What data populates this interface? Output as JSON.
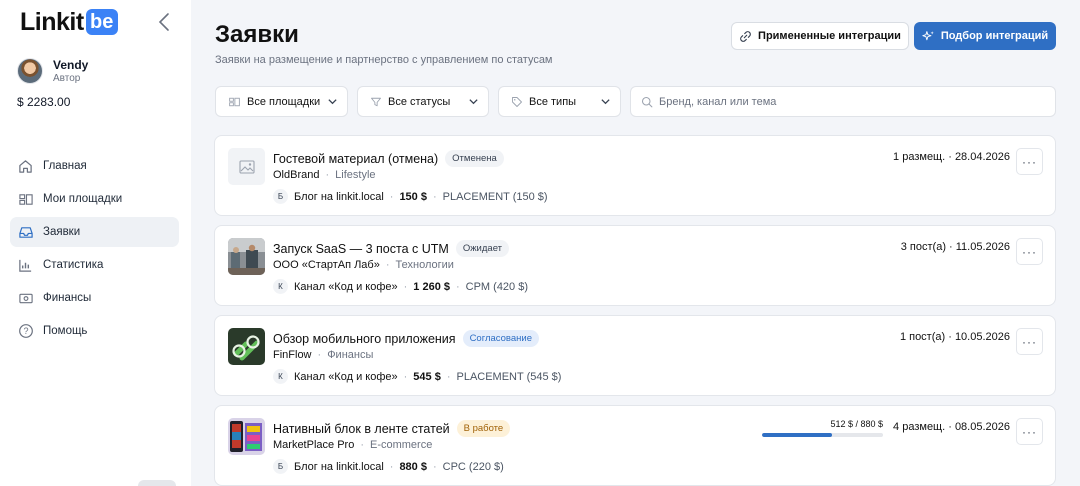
{
  "app": {
    "logo_text": "Linkit",
    "logo_box": "be",
    "user_name": "Vendy",
    "user_role": "Автор",
    "balance": "$ 2283.00"
  },
  "nav": [
    {
      "label": "Главная",
      "icon": "home-icon"
    },
    {
      "label": "Мои площадки",
      "icon": "platforms-icon"
    },
    {
      "label": "Заявки",
      "icon": "inbox-icon",
      "active": true
    },
    {
      "label": "Статистика",
      "icon": "stats-icon"
    },
    {
      "label": "Финансы",
      "icon": "finance-icon"
    },
    {
      "label": "Помощь",
      "icon": "help-icon"
    }
  ],
  "header": {
    "title": "Заявки",
    "subtitle": "Заявки на размещение и партнерство с управлением по статусам",
    "applied_label": "Примененные интеграции",
    "select_label": "Подбор интеграций"
  },
  "filters": {
    "platforms": "Все площадки",
    "statuses": "Все статусы",
    "types": "Все типы",
    "search_placeholder": "Бренд, канал или тема"
  },
  "colors": {
    "accent": "#2f6fc4",
    "badge_cancelled_bg": "#f1f3f6",
    "badge_pending_bg": "#f1f3f6",
    "badge_approval_bg": "#e4edfb",
    "badge_inwork_bg": "#fdf1d8"
  },
  "requests": [
    {
      "title": "Гостевой материал (отмена)",
      "status": "Отменена",
      "brand": "OldBrand",
      "category": "Lifestyle",
      "channel_initial": "Б",
      "channel": "Блог на linkit.local",
      "amount": "150 $",
      "model": "PLACEMENT (150 $)",
      "date": "1 размещ. · 28.04.2026"
    },
    {
      "title": "Запуск SaaS — 3 поста с UTM",
      "status": "Ожидает",
      "brand": "ООО «СтартАп Лаб»",
      "category": "Технологии",
      "channel_initial": "К",
      "channel": "Канал «Код и кофе»",
      "amount": "1 260 $",
      "model": "CPM (420 $)",
      "date": "3 пост(а) · 11.05.2026"
    },
    {
      "title": "Обзор мобильного приложения",
      "status": "Согласование",
      "brand": "FinFlow",
      "category": "Финансы",
      "channel_initial": "К",
      "channel": "Канал «Код и кофе»",
      "amount": "545 $",
      "model": "PLACEMENT (545 $)",
      "date": "1 пост(а) · 10.05.2026"
    },
    {
      "title": "Нативный блок в ленте статей",
      "status": "В работе",
      "brand": "MarketPlace Pro",
      "category": "E-commerce",
      "channel_initial": "Б",
      "channel": "Блог на linkit.local",
      "amount": "880 $",
      "model": "CPC (220 $)",
      "date": "4 размещ. · 08.05.2026",
      "progress_text": "512 $ / 880 $",
      "progress_fraction": 0.58
    }
  ]
}
